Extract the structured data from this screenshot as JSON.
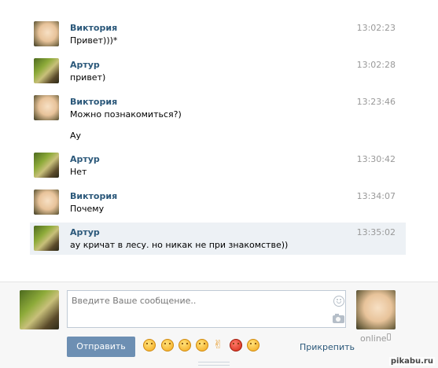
{
  "messages": [
    {
      "author": "Виктория",
      "time": "13:02:23",
      "text": "Привет)))*"
    },
    {
      "author": "Артур",
      "time": "13:02:28",
      "text": "привет)"
    },
    {
      "author": "Виктория",
      "time": "13:23:46",
      "text": "Можно познакомиться?)",
      "text2": "Ау"
    },
    {
      "author": "Артур",
      "time": "13:30:42",
      "text": "Нет"
    },
    {
      "author": "Виктория",
      "time": "13:34:07",
      "text": "Почему"
    },
    {
      "author": "Артур",
      "time": "13:35:02",
      "text": "ау кричат в лесу. но никак не при знакомстве))"
    }
  ],
  "composer": {
    "placeholder": "Введите Ваше сообщение..",
    "send_label": "Отправить",
    "attach_label": "Прикрепить",
    "online_label": "online",
    "emoji_icons": [
      "smile-emoji-icon",
      "shocked-emoji-icon",
      "grin-emoji-icon",
      "wink-emoji-icon",
      "victory-hand-emoji-icon",
      "angry-emoji-icon",
      "blush-emoji-icon"
    ]
  },
  "watermark": "pikabu.ru",
  "colors": {
    "name": "#2b587a",
    "time": "#999999",
    "button": "#6d8fb3",
    "highlight": "#edf1f5"
  }
}
